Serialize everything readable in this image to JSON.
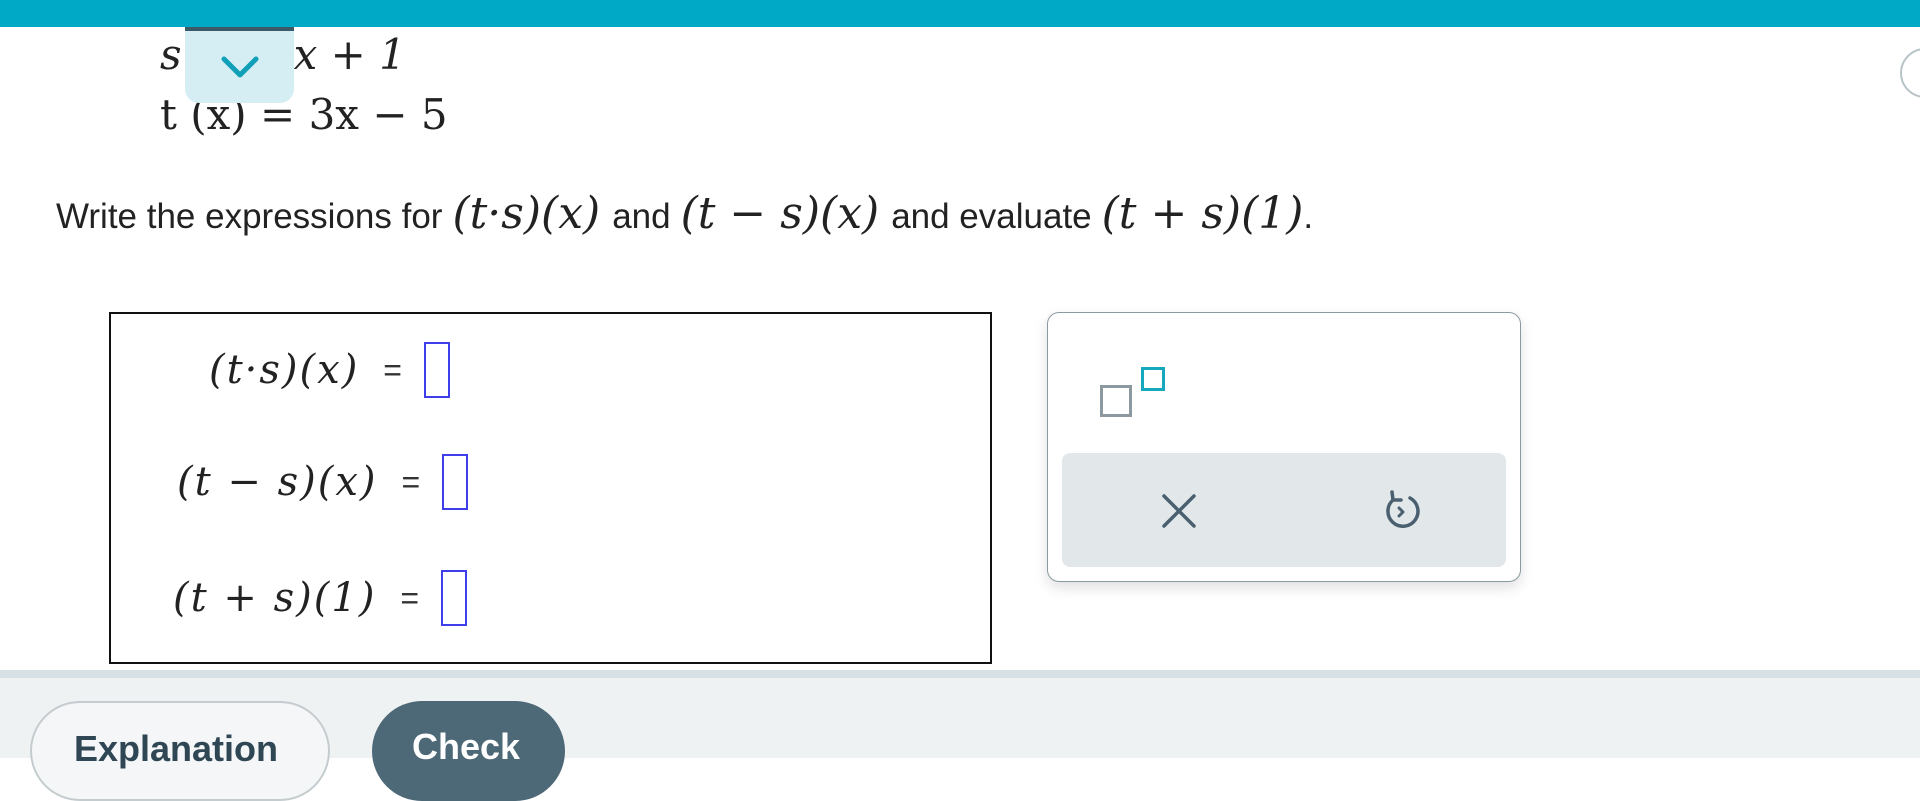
{
  "given": {
    "s_name": "s",
    "s_visible_rhs": "x + 1",
    "t_line": "t (x) = 3x − 5"
  },
  "prompt": {
    "text_before": "Write the expressions for",
    "expr1": "(t·s)(x)",
    "joiner1": "and",
    "expr2": "(t − s)(x)",
    "joiner2": "and evaluate",
    "expr3": "(t + s)(1)",
    "period": "."
  },
  "answers": [
    {
      "lhs": "(t·s)(x)",
      "eq": "=",
      "value": ""
    },
    {
      "lhs": "(t − s)(x)",
      "eq": "=",
      "value": ""
    },
    {
      "lhs": "(t + s)(1)",
      "eq": "=",
      "value": ""
    }
  ],
  "palette": {
    "exponent_icon": "superscript-template-icon",
    "clear_icon": "close-icon",
    "undo_icon": "undo-icon"
  },
  "footer": {
    "explanation_label": "Explanation",
    "check_label": "Check"
  },
  "colors": {
    "topbar": "#00aac6",
    "accent": "#16a9bd",
    "check_button": "#4d6877",
    "answer_slot_border": "#3e3eea"
  }
}
